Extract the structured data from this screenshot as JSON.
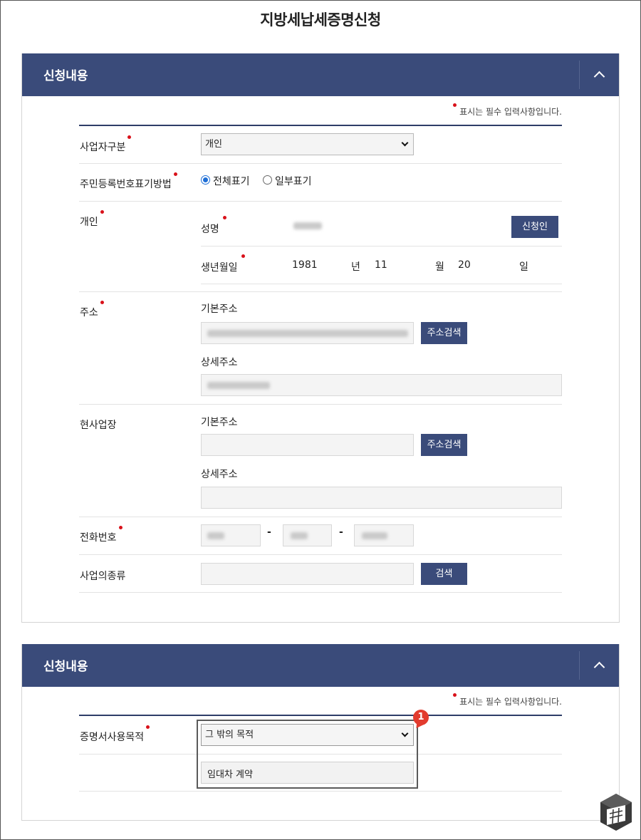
{
  "page_title": "지방세납세증명신청",
  "section1": {
    "title": "신청내용",
    "required_note": "표시는 필수 입력사항입니다.",
    "business_type": {
      "label": "사업자구분",
      "value": "개인"
    },
    "rrn_display": {
      "label": "주민등록번호표기방법",
      "options": [
        "전체표기",
        "일부표기"
      ],
      "selected": "전체표기"
    },
    "individual": {
      "label": "개인",
      "name_label": "성명",
      "applicant_button": "신청인",
      "birth_label": "생년월일",
      "birth_year": "1981",
      "year_unit": "년",
      "birth_month": "11",
      "month_unit": "월",
      "birth_day": "20",
      "day_unit": "일"
    },
    "address": {
      "label": "주소",
      "basic_label": "기본주소",
      "search_button": "주소검색",
      "detail_label": "상세주소"
    },
    "business_site": {
      "label": "현사업장",
      "basic_label": "기본주소",
      "search_button": "주소검색",
      "detail_label": "상세주소"
    },
    "phone": {
      "label": "전화번호",
      "separator": "-"
    },
    "business_kind": {
      "label": "사업의종류",
      "search_button": "검색"
    }
  },
  "section2": {
    "title": "신청내용",
    "required_note": "표시는 필수 입력사항입니다.",
    "purpose": {
      "label": "증명서사용목적",
      "value": "그 밖의 목적",
      "detail": "임대차 계약"
    },
    "annotation_badge": "1"
  },
  "colors": {
    "header": "#3a4b7a",
    "required_dot": "#d9111a",
    "badge": "#e23b2e"
  }
}
